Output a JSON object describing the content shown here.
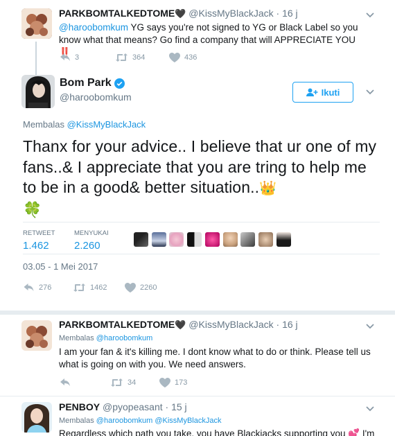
{
  "tweet1": {
    "name": "PARKBOMTALKEDTOME",
    "handle": "@KissMyBlackJack",
    "time": "16 j",
    "mention": "@haroobomkum",
    "text": " YG says you're not signed to YG or Black Label so you know what that means? Go find a company that will APPRECIATE YOU ",
    "emoji": "‼️",
    "reply_count": "3",
    "retweet_count": "364",
    "like_count": "436"
  },
  "main_tweet": {
    "name": "Bom Park",
    "handle": "@haroobomkum",
    "follow_label": "Ikuti",
    "replying_prefix": "Membalas ",
    "replying_to": "@KissMyBlackJack",
    "text": "Thanx for your advice.. I believe that ur one of my fans..& I appreciate that you are tring to help me to be in a good& better situation..",
    "emoji_crown": "👑",
    "emoji_clover": "🍀",
    "retweet_label": "RETWEET",
    "retweet_count": "1.462",
    "like_label": "MENYUKAI",
    "like_count": "2.260",
    "timestamp": "03.05 - 1 Mei 2017",
    "reply_count": "276",
    "action_retweet": "1462",
    "action_like": "2260"
  },
  "reply1": {
    "name": "PARKBOMTALKEDTOME",
    "handle": "@KissMyBlackJack",
    "time": "16 j",
    "replying_prefix": "Membalas ",
    "replying_to": "@haroobomkum",
    "text": "I am your fan & it's killing me. I dont know what to do or think. Please tell us what is going on with you. We need answers.",
    "retweet_count": "34",
    "like_count": "173"
  },
  "reply2": {
    "name": "PENBOY",
    "handle": "@pyopeasant",
    "time": "15 j",
    "replying_prefix": "Membalas ",
    "replying_to": "@haroobomkum @KissMyBlackJack",
    "text": "Regardless which path you take, you have Blackjacks supporting you",
    "emoji": "💕",
    "text_tail": " I'm"
  },
  "colors": {
    "accent": "#1da1f2",
    "link": "#1b95e0",
    "verified": "#1da1f2",
    "alert_red": "#e0245e"
  },
  "icons": {
    "caret": "chevron-down-icon",
    "reply": "reply-icon",
    "retweet": "retweet-icon",
    "like": "heart-icon",
    "verified": "verified-badge-icon",
    "follow": "follow-user-icon"
  }
}
